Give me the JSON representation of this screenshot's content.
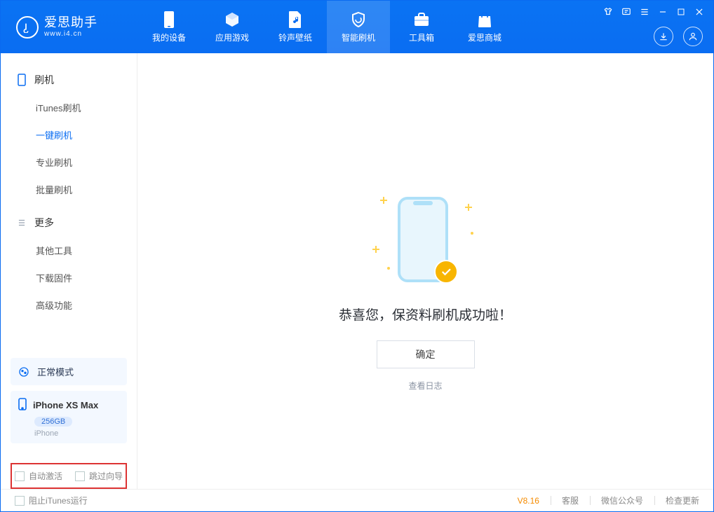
{
  "app": {
    "title": "爱思助手",
    "subtitle": "www.i4.cn"
  },
  "nav": {
    "my_device": "我的设备",
    "apps_games": "应用游戏",
    "ringtones": "铃声壁纸",
    "smart_flash": "智能刷机",
    "toolbox": "工具箱",
    "store": "爱思商城"
  },
  "sidebar": {
    "group_flash": "刷机",
    "itunes_flash": "iTunes刷机",
    "one_key_flash": "一键刷机",
    "pro_flash": "专业刷机",
    "batch_flash": "批量刷机",
    "group_more": "更多",
    "other_tools": "其他工具",
    "download_fw": "下载固件",
    "advanced": "高级功能",
    "mode_label": "正常模式",
    "device_name": "iPhone XS Max",
    "device_capacity": "256GB",
    "device_type": "iPhone",
    "auto_activate": "自动激活",
    "skip_wizard": "跳过向导"
  },
  "main": {
    "success_text": "恭喜您，保资料刷机成功啦！",
    "ok_label": "确定",
    "view_log": "查看日志"
  },
  "footer": {
    "block_itunes": "阻止iTunes运行",
    "version": "V8.16",
    "support": "客服",
    "wechat": "微信公众号",
    "check_update": "检查更新"
  }
}
